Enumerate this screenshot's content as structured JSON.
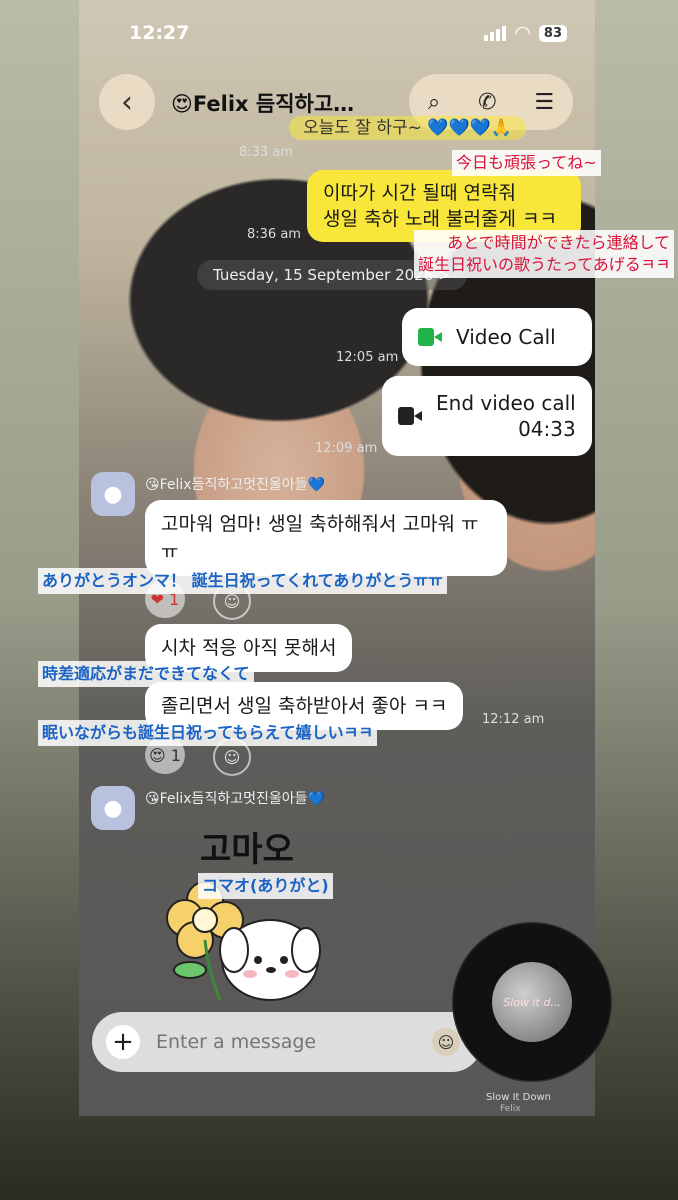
{
  "status": {
    "time": "12:27",
    "battery": "83"
  },
  "header": {
    "title": "😍Felix 듬직하고…"
  },
  "messages": {
    "partial_top": "오늘도 잘 하구~ 💙💙💙🙏",
    "ts_1": "8:33 am",
    "yellow_1_line1": "이따가 시간 될때 연락줘",
    "yellow_1_line2": "생일 축하 노래 불러줄게 ㅋㅋ",
    "ts_2": "8:36 am",
    "date": "Tuesday, 15 September 2026 >",
    "video_call": "Video Call",
    "ts_3": "12:05 am",
    "end_call": "End video call",
    "end_call_duration": "04:33",
    "ts_4": "12:09 am",
    "sender_1": "😘Felix듬직하고멋진울아들💙",
    "white_1": "고마워 엄마! 생일 축하해줘서 고마워 ㅠㅠ",
    "reaction_1": "❤ 1",
    "white_2": "시차 적응 아직 못해서",
    "white_3": "졸리면서 생일 축하받아서 좋아 ㅋㅋ",
    "ts_5": "12:12 am",
    "reaction_2": "😍 1",
    "sender_2": "😘Felix듬직하고멋진울아들💙",
    "sticker_text": "고마오"
  },
  "translations": {
    "jp_1": "今日も頑張ってね~",
    "jp_2_line1": "あとで時間ができたら連絡して",
    "jp_2_line2": "誕生日祝いの歌うたってあげるㅋㅋ",
    "jp_3": "ありがとうオンマ！ 誕生日祝ってくれてありがとうㅠㅠ",
    "jp_4": "時差適応がまだできてなくて",
    "jp_5": "眠いながらも誕生日祝ってもらえて嬉しいㅋㅋ",
    "jp_6": "コマオ(ありがと)"
  },
  "input": {
    "placeholder": "Enter a message"
  },
  "music": {
    "title": "Slow It Down",
    "artist": "Felix",
    "cover_text": "Slow it d..."
  },
  "colors": {
    "yellow_bubble": "#f8e63a",
    "video_green": "#1fb34a",
    "jp_red": "#d8123a",
    "jp_blue": "#1a63c4"
  }
}
